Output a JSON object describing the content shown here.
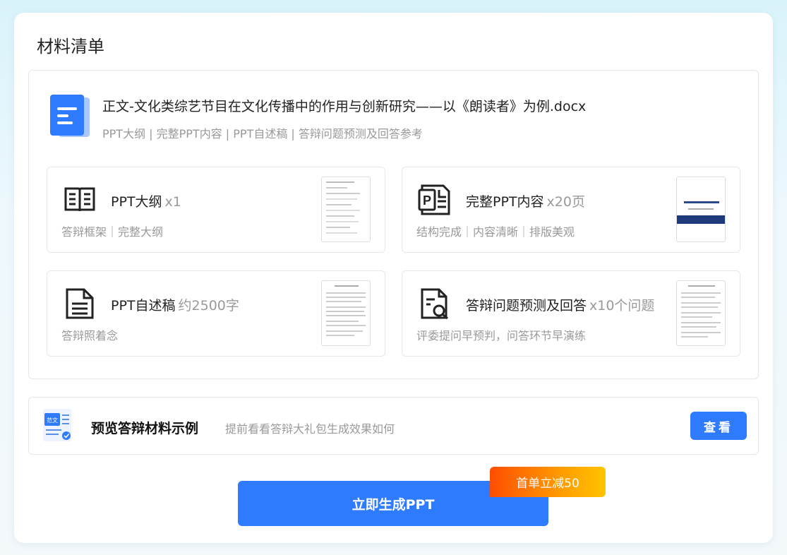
{
  "panel": {
    "title": "材料清单"
  },
  "file": {
    "name": "正文-文化类综艺节目在文化传播中的作用与创新研究——以《朗读者》为例.docx",
    "contents": "PPT大纲 | 完整PPT内容 | PPT自述稿 | 答辩问题预测及回答参考"
  },
  "items": [
    {
      "name": "PPT大纲",
      "qty": "x1",
      "desc": "答辩框架｜完整大纲",
      "icon": "open-book-icon"
    },
    {
      "name": "完整PPT内容",
      "qty": "x20页",
      "desc": "结构完成｜内容清晰｜排版美观",
      "icon": "ppt-file-icon"
    },
    {
      "name": "PPT自述稿",
      "qty": "约2500字",
      "desc": "答辩照着念",
      "icon": "document-lines-icon"
    },
    {
      "name": "答辩问题预测及回答",
      "qty": "x10个问题",
      "desc": "评委提问早预判，问答环节早演练",
      "icon": "document-search-icon"
    }
  ],
  "preview": {
    "title": "预览答辩材料示例",
    "desc": "提前看看答辩大礼包生成效果如何",
    "button": "查看",
    "icon_label": "范文"
  },
  "generate": {
    "button": "立即生成PPT",
    "promo": "首单立减50"
  },
  "colors": {
    "primary": "#2f7bff",
    "promo_start": "#ff4e00",
    "promo_end": "#ffc400"
  }
}
